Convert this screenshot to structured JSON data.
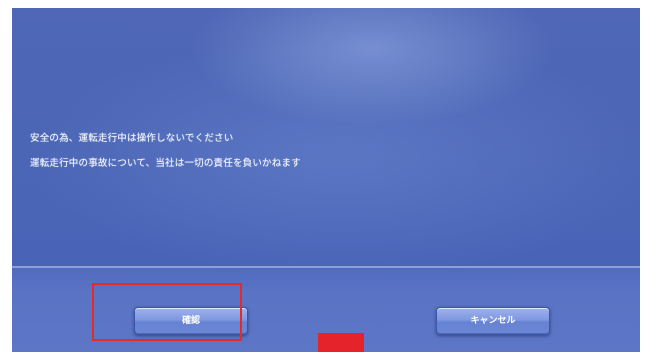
{
  "dialog": {
    "message_lines": [
      "安全の為、運転走行中は操作しないでください",
      "運転走行中の事故について、当社は一切の責任を負いかねます"
    ]
  },
  "buttons": {
    "ok_label": "確認",
    "cancel_label": "キャンセル"
  },
  "colors": {
    "screen_background": "#4c66b6",
    "highlight": "#e52a2a",
    "marker": "#e5232a"
  }
}
